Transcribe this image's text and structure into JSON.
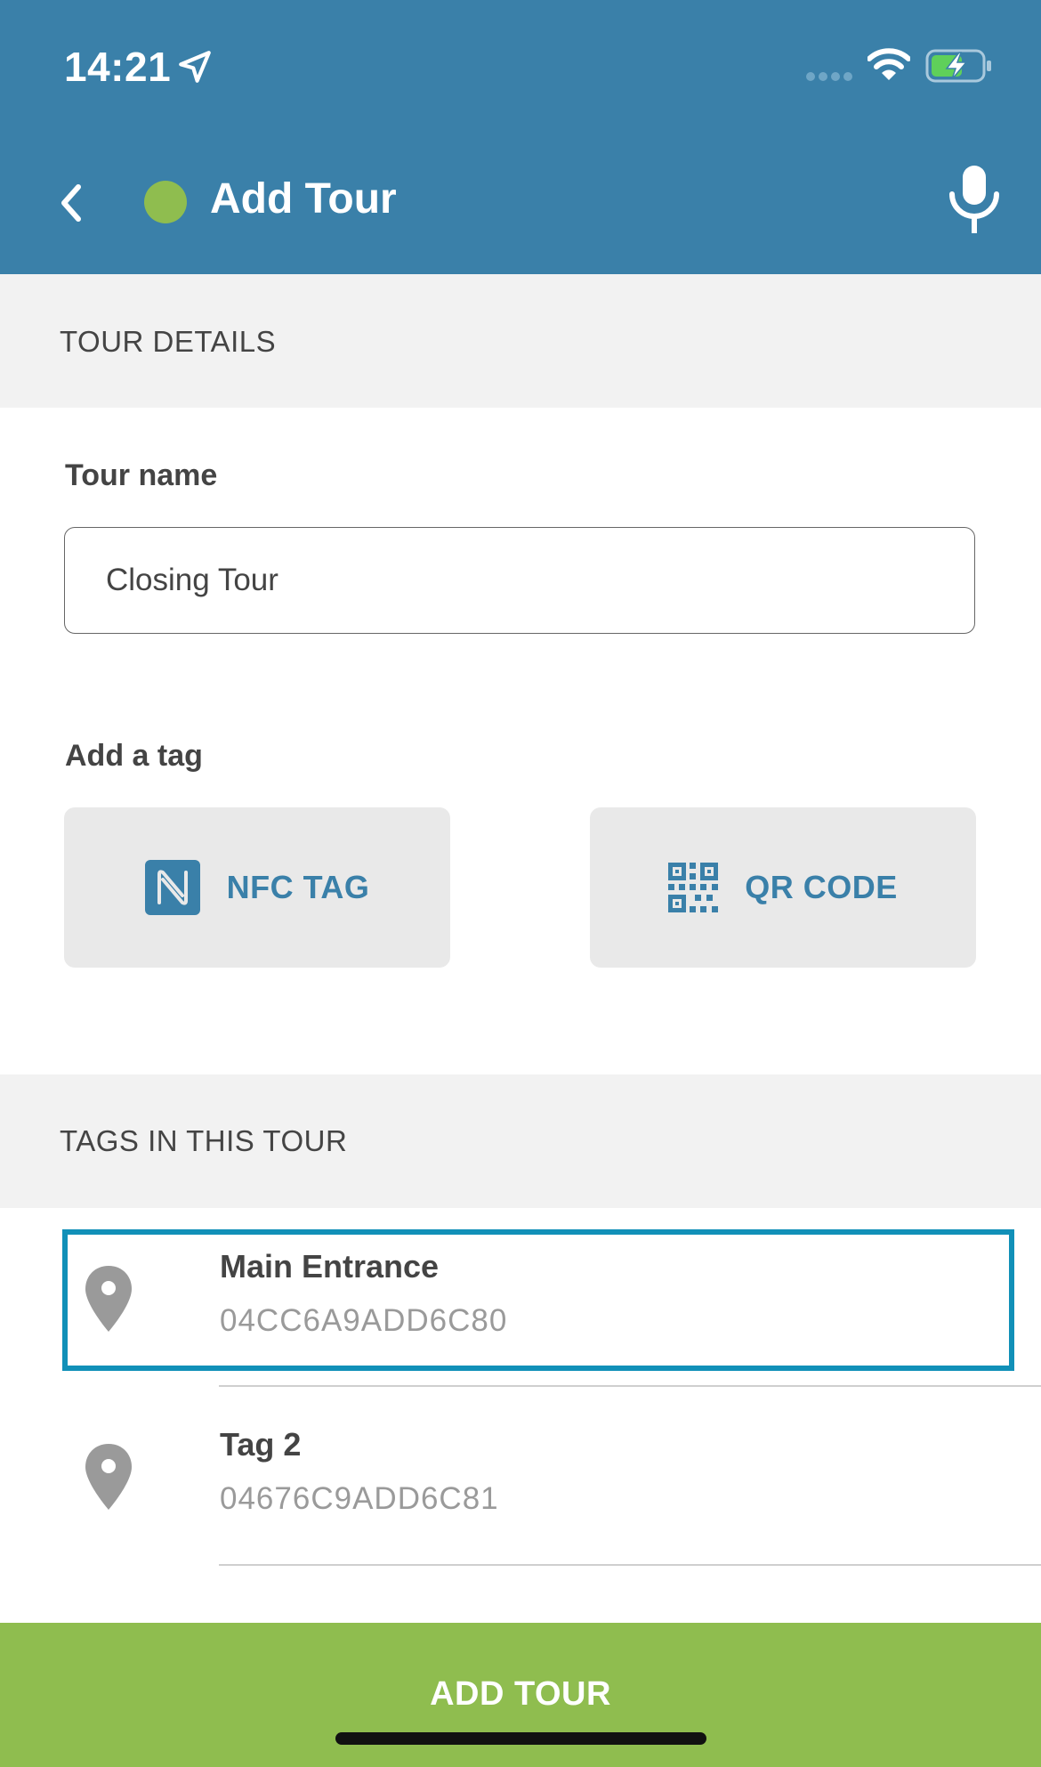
{
  "status_bar": {
    "time": "14:21",
    "icons": [
      "location-arrow-icon",
      "signal-dots-icon",
      "wifi-icon",
      "battery-charging-icon"
    ]
  },
  "header": {
    "title": "Add Tour",
    "status_dot_color": "#8fbd4f",
    "back_icon": "chevron-left-icon",
    "mic_icon": "microphone-icon",
    "background": "#3a80a9"
  },
  "tour_details": {
    "section_title": "TOUR DETAILS",
    "tour_name_label": "Tour name",
    "tour_name_value": "Closing Tour",
    "add_tag_label": "Add a tag",
    "nfc_button_label": "NFC TAG",
    "qr_button_label": "QR CODE"
  },
  "tags_section": {
    "section_title": "TAGS IN THIS TOUR",
    "items": [
      {
        "name": "Main Entrance",
        "id": "04CC6A9ADD6C80",
        "selected": true
      },
      {
        "name": "Tag 2",
        "id": "04676C9ADD6C81",
        "selected": false
      }
    ]
  },
  "footer": {
    "add_tour_label": "ADD TOUR",
    "accent": "#8fbd4f"
  }
}
